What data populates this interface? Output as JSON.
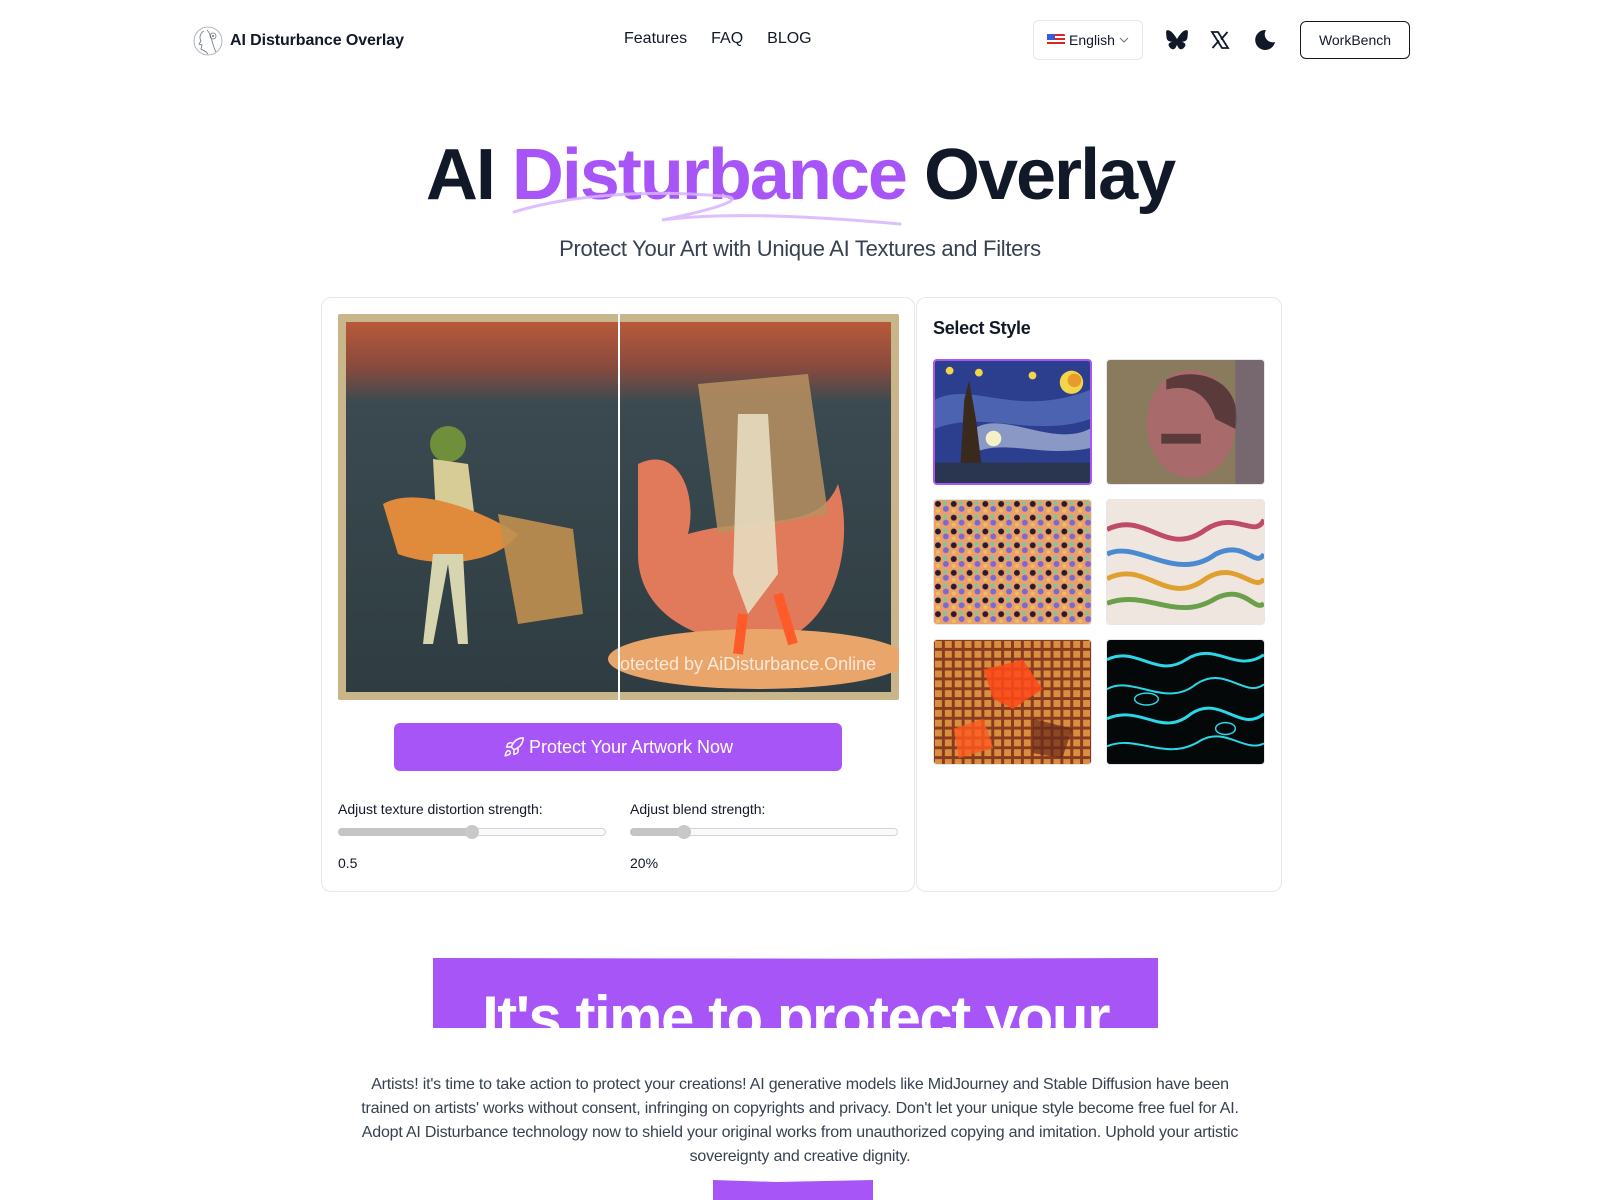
{
  "nav": {
    "brand_name": "AI Disturbance Overlay",
    "links": [
      "Features",
      "FAQ",
      "BLOG"
    ],
    "language": "English",
    "language_flag": "us-flag",
    "icons": [
      "bluesky-butterfly-icon",
      "x-twitter-icon",
      "moon-dark-mode-icon"
    ],
    "workbench_label": "WorkBench"
  },
  "hero": {
    "title_prefix": "AI",
    "title_accent": "Disturbance",
    "title_suffix": "Overlay",
    "subtitle": "Protect Your Art with Unique AI Textures and Filters",
    "accent_color": "#a855f7"
  },
  "editor": {
    "watermark": "otected by AiDisturbance.Online",
    "protect_button": "Protect Your Artwork Now",
    "protect_icon": "rocket-icon",
    "sliders": [
      {
        "label": "Adjust texture distortion strength:",
        "value_text": "0.5",
        "fraction": 0.5
      },
      {
        "label": "Adjust blend strength:",
        "value_text": "20%",
        "fraction": 0.2
      }
    ]
  },
  "styles": {
    "title": "Select Style",
    "items": [
      {
        "name": "Starry Night",
        "selected": true
      },
      {
        "name": "Pointillism Portrait",
        "selected": false
      },
      {
        "name": "Psychedelic Noise",
        "selected": false
      },
      {
        "name": "Iridescent Marble",
        "selected": false
      },
      {
        "name": "Mosaic Grid",
        "selected": false
      },
      {
        "name": "Cyan Topography",
        "selected": false
      }
    ]
  },
  "cta": {
    "heading": "It's time to protect your art!",
    "description": "Artists! it's time to take action to protect your creations! AI generative models like MidJourney and Stable Diffusion have been trained on artists' works without consent, infringing on copyrights and privacy. Don't let your unique style become free fuel for AI. Adopt AI Disturbance technology now to shield your original works from unauthorized copying and imitation. Uphold your artistic sovereignty and creative dignity."
  }
}
